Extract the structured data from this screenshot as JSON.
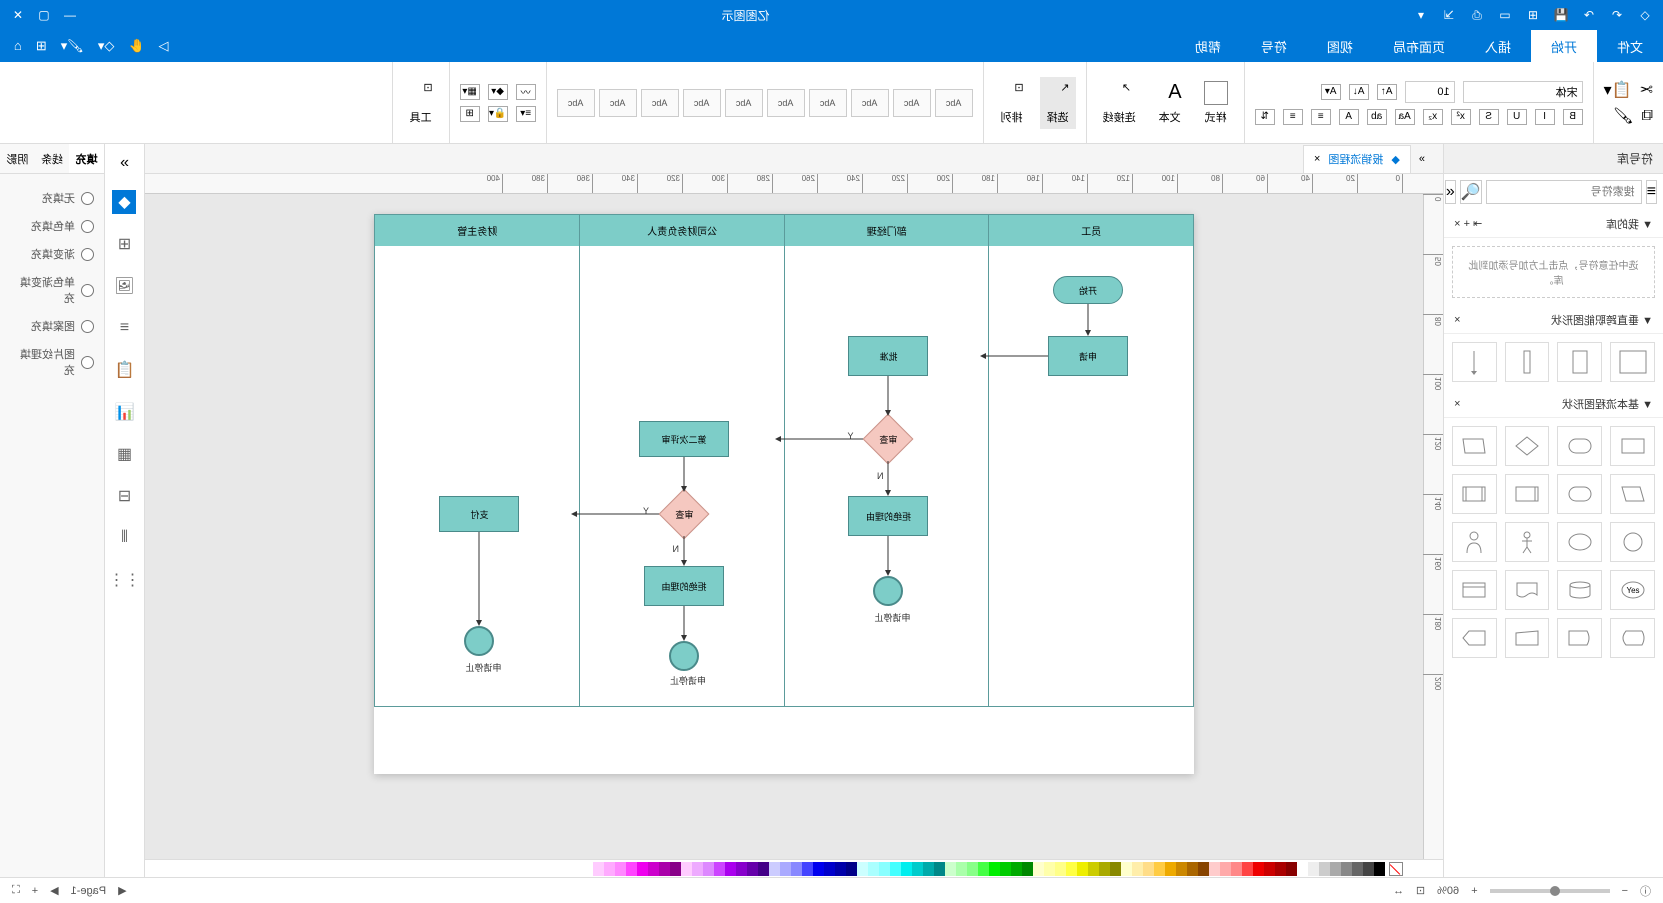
{
  "app": {
    "title": "亿图图示"
  },
  "titlebar_icons": [
    "logo",
    "undo",
    "redo",
    "save",
    "new",
    "open",
    "print",
    "export",
    "help"
  ],
  "window_controls": [
    "minimize",
    "maximize",
    "close"
  ],
  "menu": {
    "items": [
      "文件",
      "开始",
      "插入",
      "页面布局",
      "视图",
      "符号",
      "帮助"
    ],
    "active_index": 1,
    "tools": [
      "pointer",
      "hand",
      "shape-drop",
      "paint",
      "apps",
      "home"
    ]
  },
  "ribbon": {
    "clipboard": {
      "cut": "剪切",
      "copy": "复制",
      "paste": "粘贴"
    },
    "font": {
      "name": "宋体",
      "size": "10",
      "bold": "B",
      "italic": "I",
      "underline": "U",
      "strike": "S",
      "sup": "x²",
      "sub": "x₂",
      "case": "Aa",
      "clear": "A"
    },
    "style": {
      "box": "样式",
      "text": "文本",
      "connector": "连接线",
      "select": "选择",
      "arrange": "排列",
      "tools": "工具"
    },
    "themes": [
      "Abc",
      "Abc",
      "Abc",
      "Abc",
      "Abc",
      "Abc",
      "Abc",
      "Abc",
      "Abc",
      "Abc"
    ]
  },
  "left": {
    "header": "符号库",
    "search_placeholder": "搜索符号",
    "my_lib": "▼ 我的库",
    "drop_hint": "选中任意符号，点击上方加号添加到此库。",
    "sec1": "▼ 垂直跨职能图形状",
    "sec2": "▼ 基本流程图形状"
  },
  "doc_tab": {
    "name": "报销流程图",
    "close": "×"
  },
  "lanes": [
    "员工",
    "部门经理",
    "公司财务负责人",
    "财务主管"
  ],
  "shapes": {
    "start": "开始",
    "apply": "申请",
    "approve1": "批准",
    "review1": "审查",
    "reason1": "拒绝的理由",
    "end1": "申请停止",
    "review2": "第二次评审",
    "review3": "审查",
    "reason2": "拒绝的理由",
    "pay": "支付",
    "end2": "申请停止",
    "end3": "申请停止",
    "y": "Y",
    "n": "N"
  },
  "strip": [
    "diamond",
    "grid",
    "image",
    "layers",
    "clipboard",
    "chart",
    "table",
    "org",
    "align",
    "distribute"
  ],
  "right_tabs": [
    "填充",
    "线条",
    "阴影"
  ],
  "fill_options": [
    "无填充",
    "单色填充",
    "渐变填充",
    "单色渐变填充",
    "图案填充",
    "图片纹理填充"
  ],
  "status": {
    "page": "Page-1",
    "zoom": "60%"
  },
  "ruler_h": [
    0,
    20,
    40,
    60,
    80,
    100,
    120,
    140,
    160,
    180,
    200,
    220,
    240,
    260,
    280,
    300,
    320,
    340,
    360,
    380,
    400
  ],
  "ruler_v": [
    0,
    50,
    80,
    100,
    120,
    140,
    160,
    180,
    200
  ],
  "colors": [
    "#000",
    "#444",
    "#666",
    "#888",
    "#aaa",
    "#ccc",
    "#eee",
    "#fff",
    "#800",
    "#a00",
    "#c00",
    "#e00",
    "#f44",
    "#f88",
    "#faa",
    "#fcc",
    "#840",
    "#a60",
    "#c80",
    "#ea0",
    "#fc4",
    "#fd8",
    "#fea",
    "#ffc",
    "#880",
    "#aa0",
    "#cc0",
    "#ee0",
    "#ff4",
    "#ff8",
    "#ffa",
    "#ffc",
    "#080",
    "#0a0",
    "#0c0",
    "#0e0",
    "#4f4",
    "#8f8",
    "#afa",
    "#cfc",
    "#088",
    "#0aa",
    "#0cc",
    "#0ee",
    "#4ff",
    "#8ff",
    "#aff",
    "#cff",
    "#008",
    "#00a",
    "#00c",
    "#00e",
    "#44f",
    "#88f",
    "#aaf",
    "#ccf",
    "#408",
    "#60a",
    "#80c",
    "#a0e",
    "#c4f",
    "#d8f",
    "#eaf",
    "#fcf",
    "#808",
    "#a0a",
    "#c0c",
    "#e0e",
    "#f4f",
    "#f8f",
    "#faf",
    "#fcf"
  ]
}
